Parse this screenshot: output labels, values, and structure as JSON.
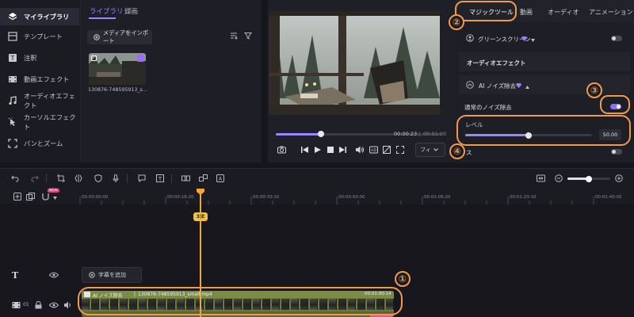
{
  "sidebar": {
    "items": [
      {
        "label": "マイライブラリ",
        "icon": "layers-icon"
      },
      {
        "label": "テンプレート",
        "icon": "template-icon"
      },
      {
        "label": "注釈",
        "icon": "text-icon"
      },
      {
        "label": "動画エフェクト",
        "icon": "film-icon"
      },
      {
        "label": "オーディオエフェクト",
        "icon": "music-icon"
      },
      {
        "label": "カーソルエフェクト",
        "icon": "cursor-icon"
      },
      {
        "label": "パンとズーム",
        "icon": "pan-zoom-icon"
      }
    ]
  },
  "library": {
    "tabs": [
      "ライブラリ",
      "録画"
    ],
    "import_label": "メディアをインポート",
    "file_name": "130876-748595913_s..."
  },
  "player": {
    "current_time": "00:00:23",
    "total_time": "00:01:00",
    "fit_label": "フィ",
    "progress": 0.27
  },
  "right_panel": {
    "tabs": [
      "マジックツール",
      "動画",
      "オーディオ",
      "アニメーション"
    ],
    "green_screen": "グリーンスクリーン",
    "audio_effects": "オーディオエフェクト",
    "ai_noise": "AI ノイズ除去",
    "normal_noise": "通常のノイズ除去",
    "level_label": "レベル",
    "level_value": "50.00",
    "level_fraction": 0.5,
    "partial_label": "ス"
  },
  "callouts": [
    "①",
    "②",
    "③",
    "④"
  ],
  "timeline": {
    "ticks": [
      "00:00:00:00",
      "00:00:16:20",
      "00:00:33:10",
      "00:00:50:00",
      "00:01:06:20",
      "00:01:23:10",
      "00:01:40:00"
    ],
    "new_badge": "NEW",
    "playhead_badge": "3|E",
    "add_caption": "字幕を追加",
    "track_number": "01",
    "clip_label": "AI ノイズ除去",
    "clip_file": "130876-748595913_small.mp4",
    "clip_time": "00:01:00:14"
  },
  "colors": {
    "accent": "#9a86ff",
    "callout": "#f09a4e",
    "playhead": "#f0a63a",
    "clip": "#6c7a3a"
  }
}
